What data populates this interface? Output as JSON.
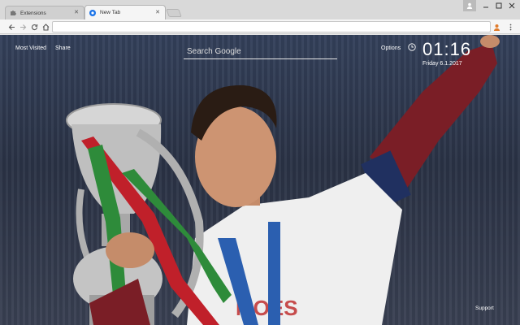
{
  "browser": {
    "tabs": [
      {
        "label": "Extensions",
        "icon": "puzzle-icon",
        "active": false
      },
      {
        "label": "New Tab",
        "icon": "newtab-icon",
        "active": true
      }
    ],
    "close_glyph": "✕",
    "omnibox": {
      "value": "",
      "placeholder": ""
    }
  },
  "newtab": {
    "most_visited_label": "Most Visited",
    "share_label": "Share",
    "search_placeholder": "Search Google",
    "options_label": "Options",
    "time": "01:16",
    "date": "Friday  6.1.2017",
    "support_label": "Support"
  },
  "colors": {
    "accent": "#1a73e8",
    "shirt_red": "#7a1e26",
    "ribbon_green": "#2e8b3a",
    "ribbon_red": "#c0202a"
  }
}
